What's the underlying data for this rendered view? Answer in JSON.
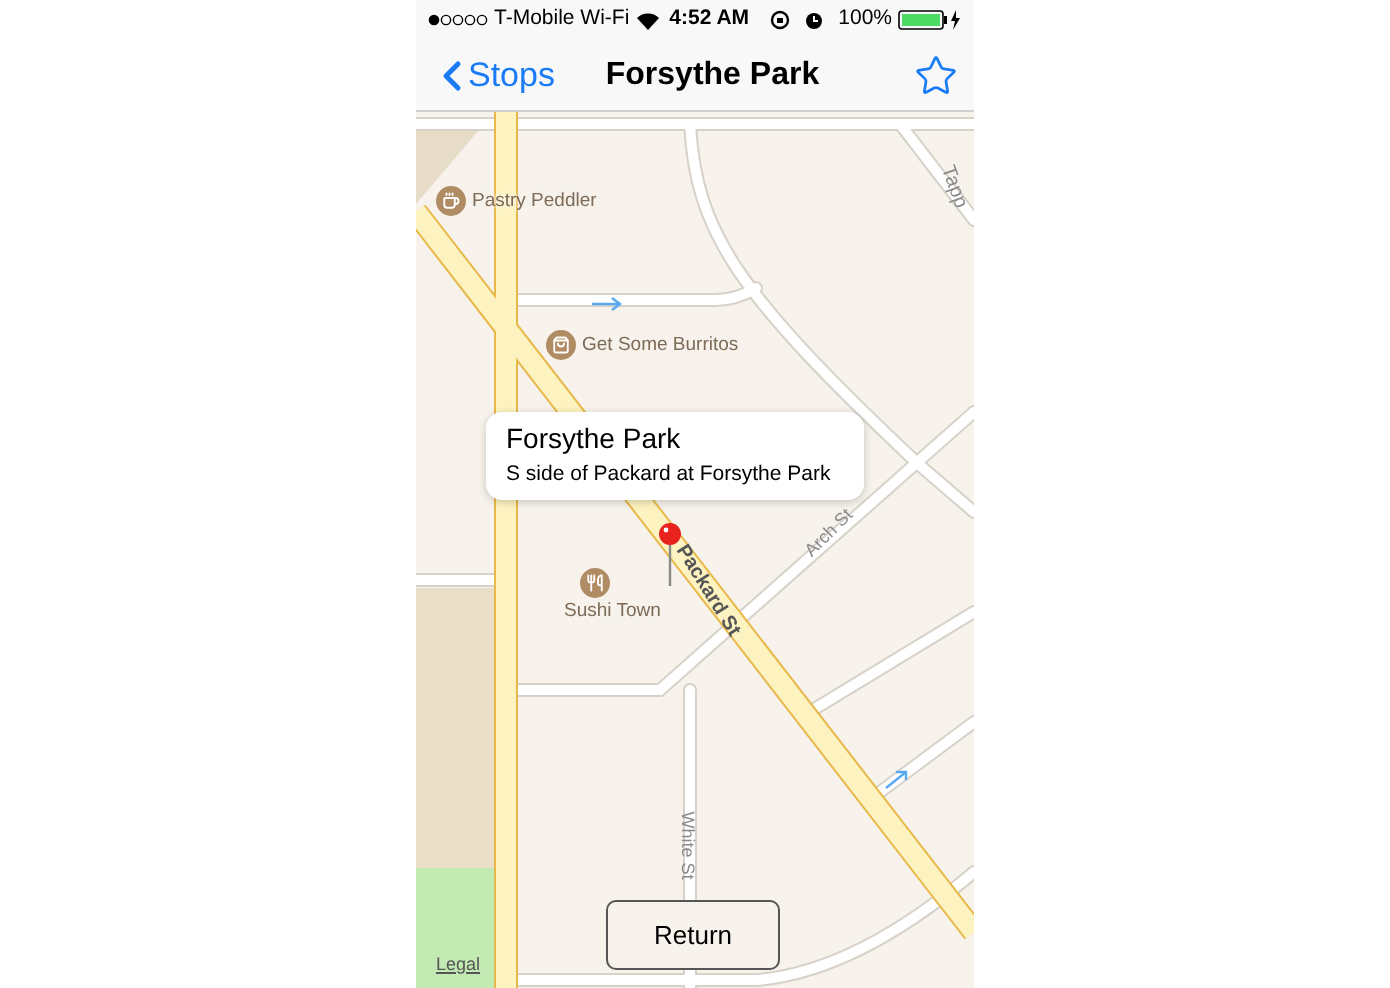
{
  "status_bar": {
    "carrier": "T-Mobile Wi-Fi",
    "time": "4:52 AM",
    "battery": "100%"
  },
  "nav_bar": {
    "back": "Stops",
    "title": "Forsythe Park",
    "starred": false
  },
  "map": {
    "places": [
      {
        "name": "Pastry Peddler",
        "kind": "cafe"
      },
      {
        "name": "Get Some Burritos",
        "kind": "takeout"
      },
      {
        "name": "Sushi Town",
        "kind": "restaurant"
      }
    ],
    "streets": [
      "Tapp",
      "Packard St",
      "Arch St",
      "White St"
    ],
    "callout": {
      "title": "Forsythe Park",
      "subtitle": "S side of Packard at Forsythe Park"
    },
    "legal": "Legal"
  },
  "button": "Return"
}
